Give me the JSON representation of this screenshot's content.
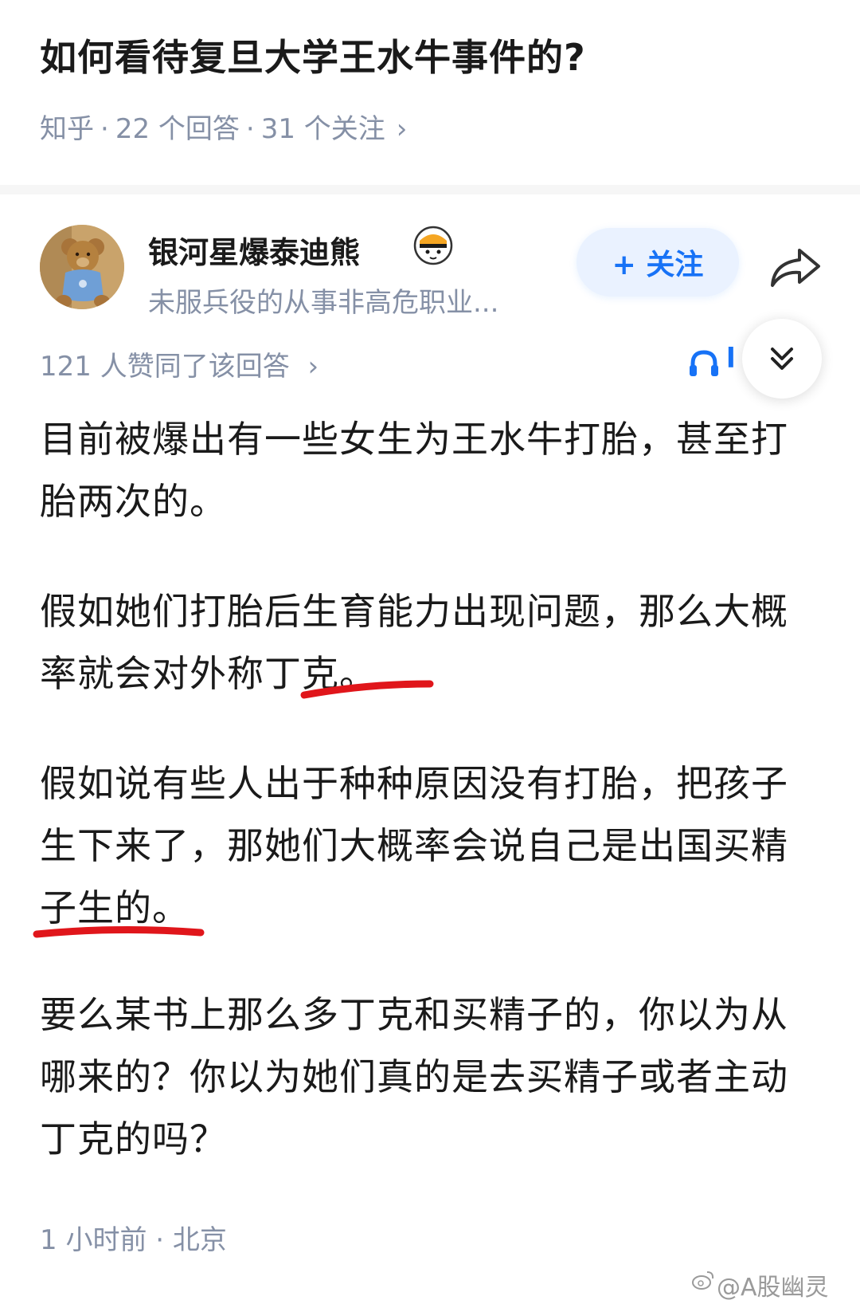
{
  "question": {
    "title": "如何看待复旦大学王水牛事件的?",
    "source": "知乎",
    "answers": "22 个回答",
    "followers": "31 个关注",
    "separator": "·",
    "chevron": "›"
  },
  "author": {
    "name": "银河星爆泰迪熊",
    "bio": "未服兵役的从事非高危职业...",
    "follow_label": "+ 关注",
    "badge_icon": "verified-badge-icon",
    "share_icon": "share-icon"
  },
  "answer_meta": {
    "votes": "121 人赞同了该回答",
    "chevron": "›",
    "audio_partial": "l"
  },
  "content": {
    "paragraphs": [
      "目前被爆出有一些女生为王水牛打胎，甚至打胎两次的。",
      "假如她们打胎后生育能力出现问题，那么大概率就会对外称丁克。",
      "假如说有些人出于种种原因没有打胎，把孩子生下来了，那她们大概率会说自己是出国买精子生的。",
      "要么某书上那么多丁克和买精子的，你以为从哪来的？你以为她们真的是去买精子或者主动丁克的吗？"
    ],
    "underline_color": "#e0161b"
  },
  "footer": {
    "time_location": "1 小时前 · 北京"
  },
  "watermark": {
    "text": "@A股幽灵"
  },
  "colors": {
    "accent": "#1772f6",
    "meta_gray": "#8590a6",
    "text": "#1a1a1a"
  }
}
